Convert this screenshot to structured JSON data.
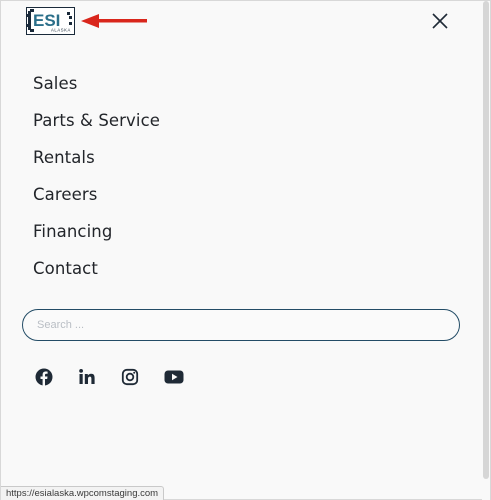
{
  "header": {
    "logo": {
      "text": "ESI",
      "subtext": "ALASKA"
    },
    "close_label": "Close menu"
  },
  "nav": {
    "items": [
      {
        "label": "Sales"
      },
      {
        "label": "Parts & Service"
      },
      {
        "label": "Rentals"
      },
      {
        "label": "Careers"
      },
      {
        "label": "Financing"
      },
      {
        "label": "Contact"
      }
    ]
  },
  "search": {
    "value": "",
    "placeholder": "Search ..."
  },
  "social": {
    "items": [
      {
        "icon": "facebook-icon"
      },
      {
        "icon": "linkedin-icon"
      },
      {
        "icon": "instagram-icon"
      },
      {
        "icon": "youtube-icon"
      }
    ]
  },
  "status_bar": {
    "url": "https://esialaska.wpcomstaging.com"
  },
  "colors": {
    "text": "#22252a",
    "search_border": "#234c66",
    "logo_teal": "#2b6f8a",
    "arrow": "#d9261c",
    "icon": "#1f2a36"
  }
}
